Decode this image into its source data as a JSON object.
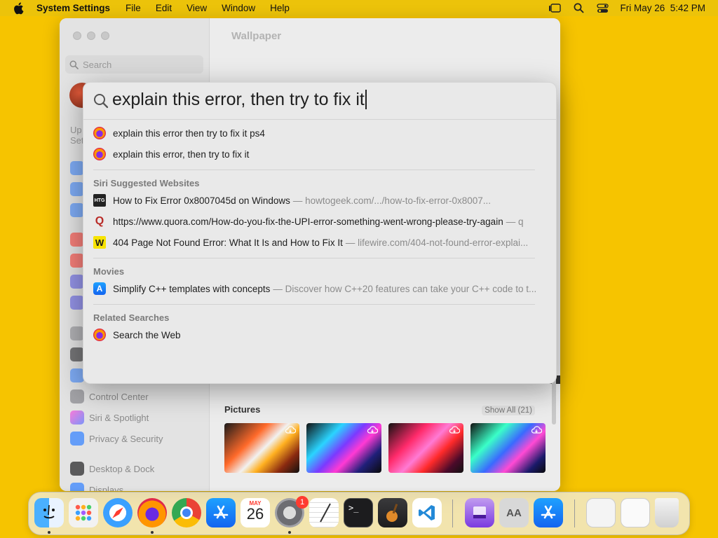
{
  "menubar": {
    "app_name": "System Settings",
    "items": [
      "File",
      "Edit",
      "View",
      "Window",
      "Help"
    ],
    "clock": "Fri May 26  5:42 PM"
  },
  "window": {
    "sidebar": {
      "search_placeholder": "Search",
      "stub_text_1": "Up",
      "stub_text_2": "Set",
      "items": [
        {
          "label": "Control Center",
          "color": "#8e8e93"
        },
        {
          "label": "Siri & Spotlight",
          "color": "#c06adf"
        },
        {
          "label": "Privacy & Security",
          "color": "#3a86ff"
        },
        {
          "label": "Desktop & Dock",
          "color": "#2c2c2e"
        },
        {
          "label": "Displays",
          "color": "#3a86ff"
        }
      ]
    },
    "content": {
      "title": "Wallpaper",
      "pictures_label": "Pictures",
      "show_all": "Show All (21)"
    }
  },
  "spotlight": {
    "query": "explain this error, then try to fix it",
    "suggestions": [
      {
        "text": "explain this error then try to fix it ps4",
        "icon": "firefox-icon"
      },
      {
        "text": "explain this error, then try to fix it",
        "icon": "firefox-icon"
      }
    ],
    "sections": {
      "siri_websites": "Siri Suggested Websites",
      "movies": "Movies",
      "related": "Related Searches"
    },
    "websites": [
      {
        "title": "How to Fix Error 0x8007045d on Windows",
        "detail": "— howtogeek.com/.../how-to-fix-error-0x8007...",
        "icon": "howtogeek-icon",
        "icon_text": "HTG"
      },
      {
        "title": "https://www.quora.com/How-do-you-fix-the-UPI-error-something-went-wrong-please-try-again",
        "detail": "— q",
        "icon": "quora-icon",
        "icon_text": "Q"
      },
      {
        "title": "404 Page Not Found Error: What It Is and How to Fix It",
        "detail": "— lifewire.com/404-not-found-error-explai...",
        "icon": "lifewire-icon",
        "icon_text": "W"
      }
    ],
    "movies": [
      {
        "title": "Simplify C++ templates with concepts",
        "detail": "— Discover how C++20 features can take your C++ code to t...",
        "icon": "app-store-icon",
        "icon_text": "A"
      }
    ],
    "related": [
      {
        "title": "Search the Web",
        "icon": "firefox-icon"
      }
    ]
  },
  "dock": {
    "calendar_month": "MAY",
    "calendar_day": "26",
    "settings_badge": "1",
    "apps": [
      "Finder",
      "Launchpad",
      "Safari",
      "Firefox",
      "Chrome",
      "App Store",
      "Calendar",
      "System Settings",
      "TextEdit",
      "Terminal",
      "GarageBand",
      "VS Code",
      "Archive",
      "Font Book",
      "App Store"
    ]
  }
}
